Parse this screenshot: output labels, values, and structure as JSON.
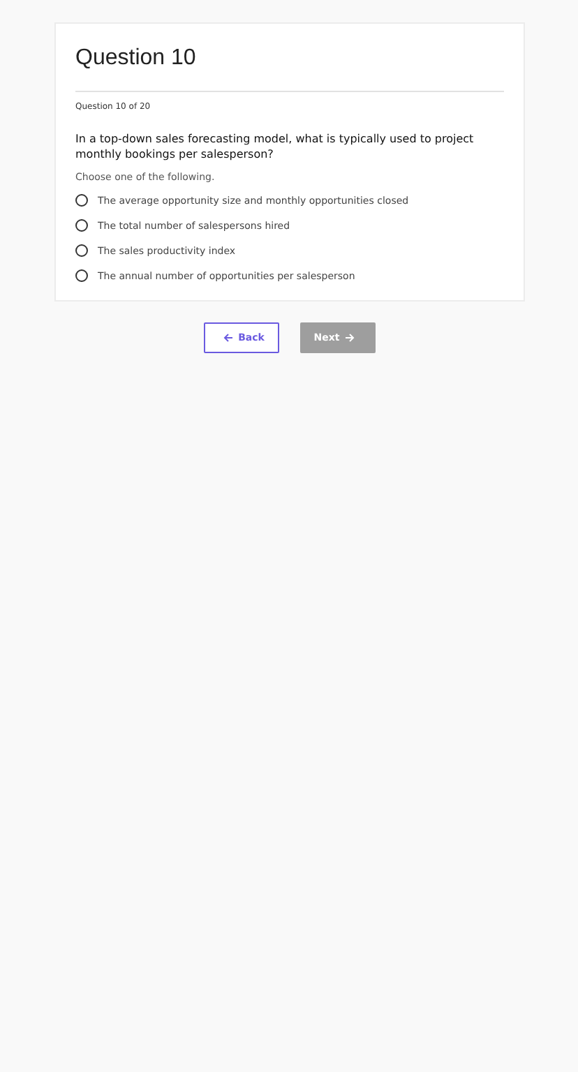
{
  "title": "Question 10",
  "progress": "Question 10 of 20",
  "question": "In a top-down sales forecasting model, what is typically used to project monthly bookings per salesperson?",
  "instruction": "Choose one of the following.",
  "options": [
    {
      "label": "The average opportunity size and monthly opportunities closed",
      "selected": false
    },
    {
      "label": "The total number of salespersons hired",
      "selected": false
    },
    {
      "label": "The sales productivity index",
      "selected": false
    },
    {
      "label": "The annual number of opportunities per salesperson",
      "selected": false
    }
  ],
  "buttons": [
    {
      "label": "Back",
      "kind": "back",
      "disabled": false
    },
    {
      "label": "Next",
      "kind": "next",
      "disabled": true
    }
  ]
}
